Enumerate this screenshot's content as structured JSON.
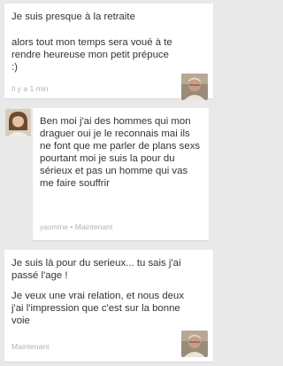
{
  "messages": [
    {
      "sender": "me",
      "paragraphs": [
        "Je suis presque à la retraite",
        "alors tout mon temps sera voué à te rendre heureuse mon petit prépuce :)"
      ],
      "timestamp": "Il y a 1 min",
      "avatar_icon": "man-avatar"
    },
    {
      "sender": "yasmine",
      "paragraphs": [
        "Ben moi j'ai des hommes qui mon draguer oui je le reconnais mai ils ne font que me parler de plans sexs pourtant moi je suis la pour du sérieux et pas un homme qui vas me faire souffrir"
      ],
      "meta": {
        "name": "yasmine",
        "separator": "•",
        "time": "Maintenant"
      },
      "avatar_icon": "woman-avatar"
    },
    {
      "sender": "me",
      "paragraphs": [
        "Je suis là pour du serieux... tu sais j'ai passé l'age !",
        "Je veux une vrai relation, et nous deux j'ai l'impression que c'est sur la bonne voie"
      ],
      "timestamp": "Maintenant",
      "avatar_icon": "man-avatar"
    }
  ],
  "colors": {
    "background": "#e9e9e9",
    "bubble": "#ffffff",
    "text": "#333333",
    "meta": "#b3b3b3"
  }
}
